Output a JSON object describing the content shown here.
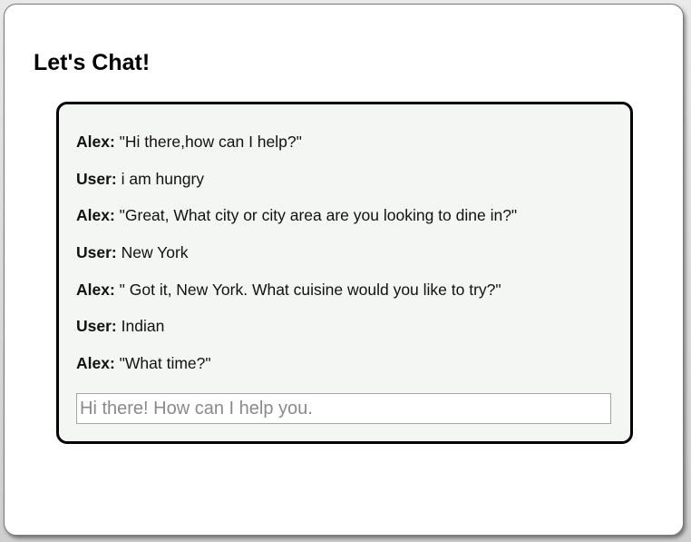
{
  "page": {
    "title": "Let's Chat!"
  },
  "chat": {
    "messages": [
      {
        "speaker": "Alex:",
        "text": "\"Hi there,how can I help?\""
      },
      {
        "speaker": "User:",
        "text": "i am hungry"
      },
      {
        "speaker": "Alex:",
        "text": "\"Great, What city or city area are you looking to dine in?\""
      },
      {
        "speaker": "User:",
        "text": "New York"
      },
      {
        "speaker": "Alex:",
        "text": "\" Got it, New York. What cuisine would you like to try?\""
      },
      {
        "speaker": "User:",
        "text": "Indian"
      },
      {
        "speaker": "Alex:",
        "text": "\"What time?\""
      }
    ],
    "input": {
      "value": "",
      "placeholder": "Hi there! How can I help you."
    }
  },
  "colors": {
    "chat_background": "#f4f6f3",
    "chat_border": "#000000",
    "input_border": "#a5a5a5"
  }
}
